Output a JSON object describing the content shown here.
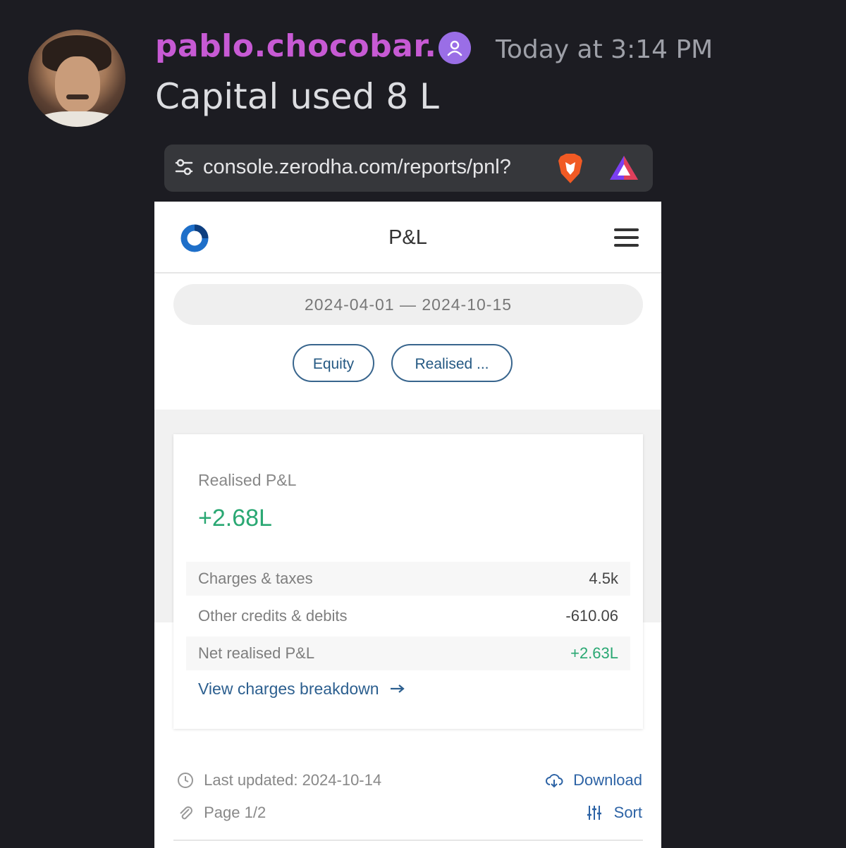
{
  "message": {
    "username": "pablo.chocobar.",
    "timestamp": "Today at 3:14 PM",
    "text": "Capital used 8 L"
  },
  "browser": {
    "url": "console.zerodha.com/reports/pnl?"
  },
  "app": {
    "page_title": "P&L",
    "date_range": "2024-04-01  —  2024-10-15",
    "filters": [
      "Equity",
      "Realised ..."
    ]
  },
  "summary": {
    "label": "Realised P&L",
    "value": "+2.68L",
    "rows": [
      {
        "label": "Charges & taxes",
        "value": "4.5k"
      },
      {
        "label": "Other credits & debits",
        "value": "-610.06"
      },
      {
        "label": "Net realised P&L",
        "value": "+2.63L"
      }
    ],
    "link": "View charges breakdown"
  },
  "footer": {
    "last_updated": "Last updated: 2024-10-14",
    "page": "Page 1/2",
    "download": "Download",
    "sort": "Sort"
  },
  "colors": {
    "username": "#c75ad4",
    "positive": "#2aa873",
    "link": "#2c5f8f"
  }
}
